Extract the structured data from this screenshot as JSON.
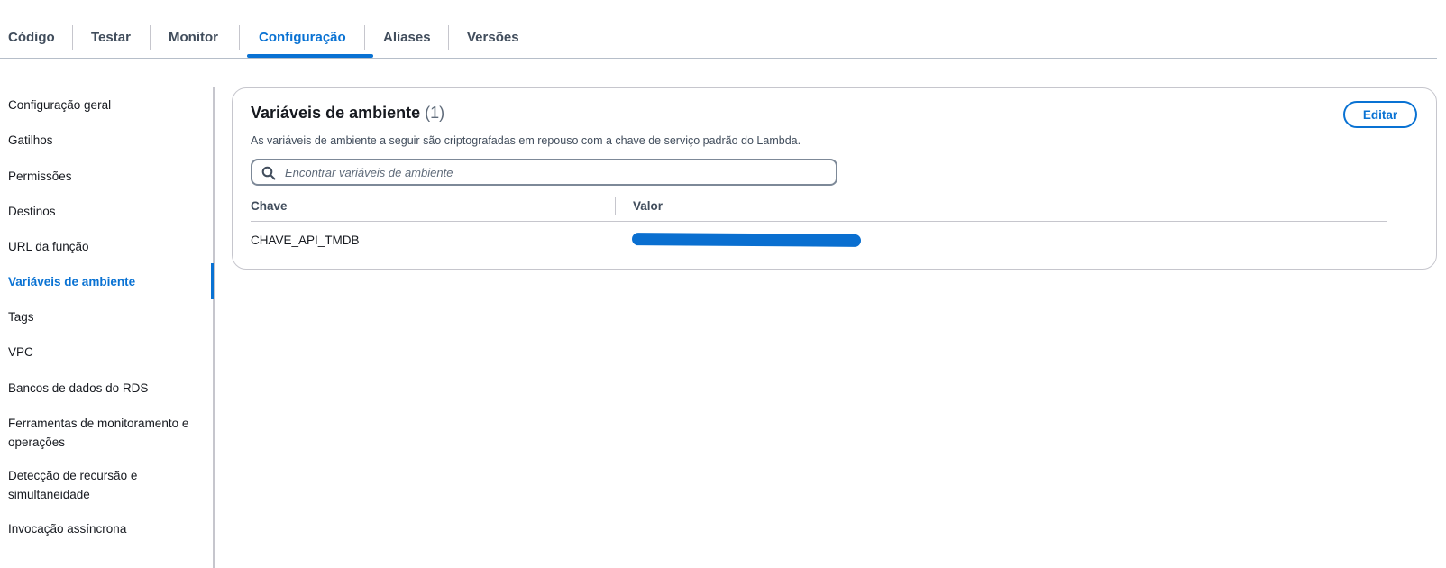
{
  "tabs": [
    {
      "label": "Código"
    },
    {
      "label": "Testar"
    },
    {
      "label": "Monitor"
    },
    {
      "label": "Configuração",
      "active": true
    },
    {
      "label": "Aliases"
    },
    {
      "label": "Versões"
    }
  ],
  "sidebar": {
    "items": [
      {
        "label": "Configuração geral"
      },
      {
        "label": "Gatilhos"
      },
      {
        "label": "Permissões"
      },
      {
        "label": "Destinos"
      },
      {
        "label": "URL da função"
      },
      {
        "label": "Variáveis de ambiente",
        "active": true
      },
      {
        "label": "Tags"
      },
      {
        "label": "VPC"
      },
      {
        "label": "Bancos de dados do RDS"
      },
      {
        "label": "Ferramentas de monitoramento e operações"
      },
      {
        "label": "Detecção de recursão e simultaneidade"
      },
      {
        "label": "Invocação assíncrona"
      }
    ]
  },
  "panel": {
    "title": "Variáveis de ambiente",
    "count": "(1)",
    "description": "As variáveis de ambiente a seguir são criptografadas em repouso com a chave de serviço padrão do Lambda.",
    "edit_label": "Editar",
    "search": {
      "placeholder": "Encontrar variáveis de ambiente",
      "value": ""
    },
    "columns": {
      "key": "Chave",
      "value": "Valor"
    },
    "rows": [
      {
        "key": "CHAVE_API_TMDB",
        "value_redacted": true
      }
    ]
  },
  "colors": {
    "accent": "#0972d3",
    "redaction": "#0a6fd0",
    "border": "#c6c6cd"
  }
}
